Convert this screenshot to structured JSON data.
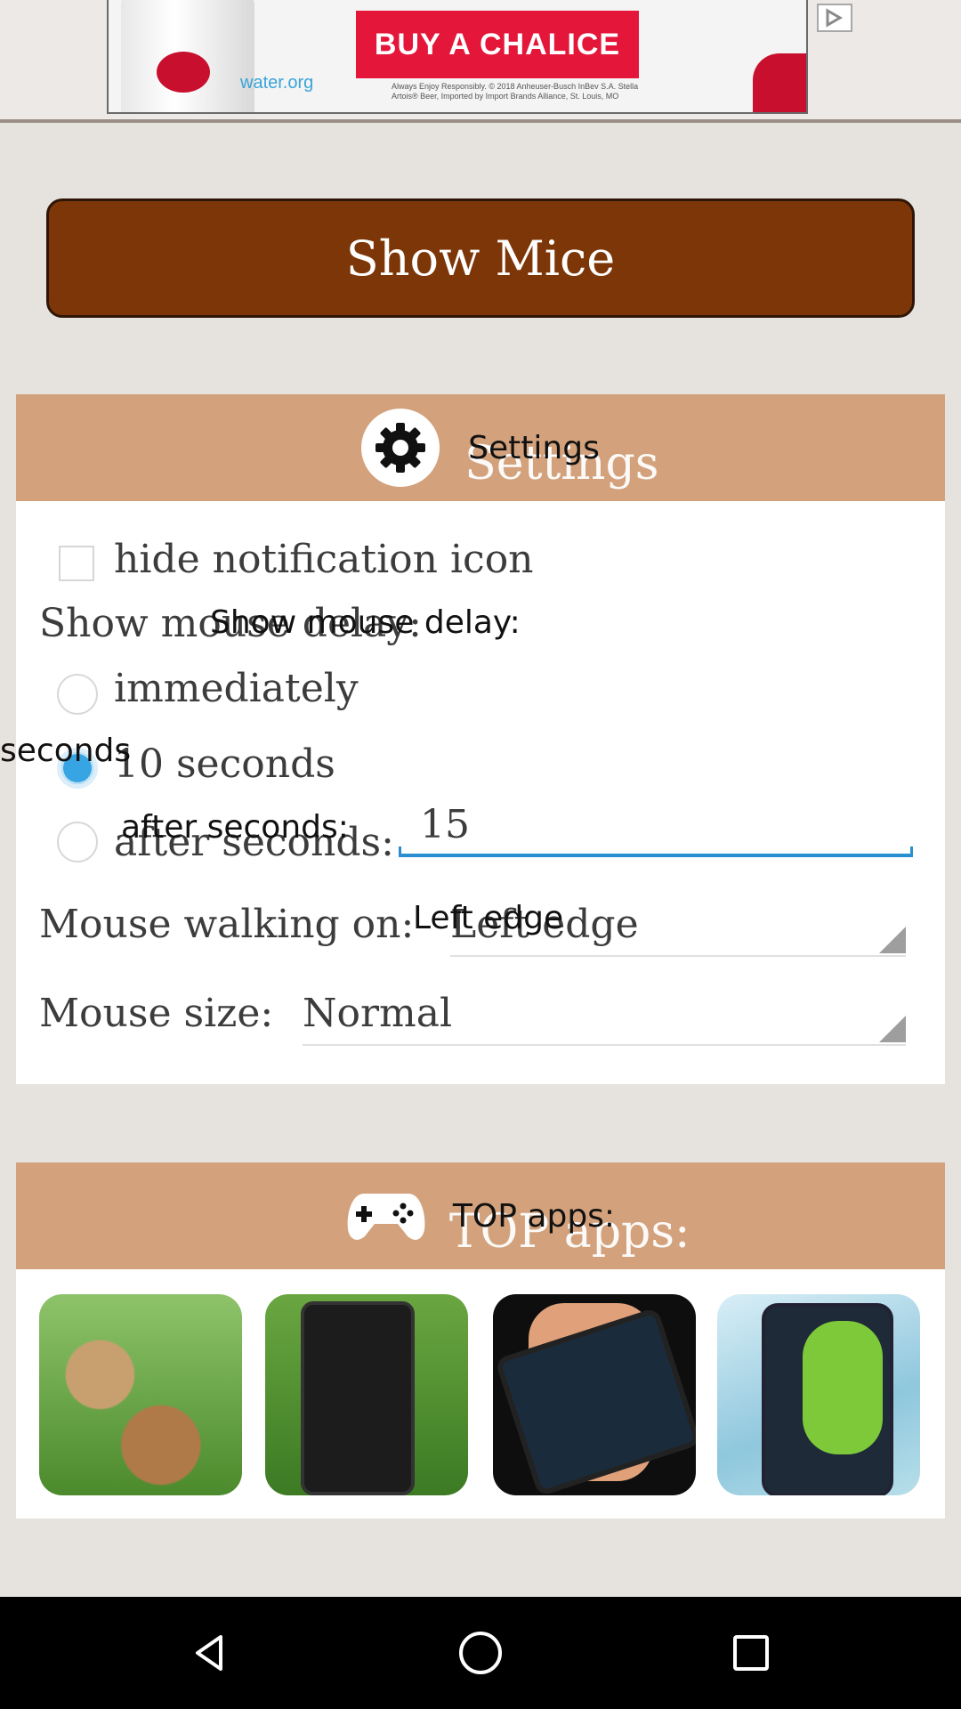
{
  "ad": {
    "cta": "BUY A CHALICE",
    "site": "water.org",
    "fine_print": "Always Enjoy Responsibly. © 2018 Anheuser-Busch InBev S.A. Stella Artois® Beer, Imported by Import Brands Alliance, St. Louis, MO",
    "brand_color": "#e4163a"
  },
  "main_button": {
    "label": "Show Mice"
  },
  "settings": {
    "header": "Settings",
    "hide_notification_label": "hide notification icon",
    "hide_notification_checked": false,
    "delay_label": "Show mouse delay:",
    "delay_overlay": "Show mouse delay:",
    "options": [
      {
        "label": "immediately",
        "selected": false
      },
      {
        "label": "10 seconds",
        "selected": true
      },
      {
        "label": "after seconds:",
        "selected": false
      }
    ],
    "seconds_overlay": "seconds",
    "after_seconds_overlay": "after seconds:",
    "after_seconds_value": "15",
    "walking_label": "Mouse walking on:",
    "walking_value": "Left edge",
    "walking_overlay": "Left edge",
    "size_label": "Mouse size:",
    "size_value": "Normal"
  },
  "top_apps": {
    "header": "TOP apps:",
    "apps": [
      {
        "icon": "snail-app-thumbnail"
      },
      {
        "icon": "ants-app-thumbnail"
      },
      {
        "icon": "xray-app-thumbnail"
      },
      {
        "icon": "frog-app-thumbnail"
      }
    ]
  },
  "colors": {
    "accent_brown": "#7d3607",
    "header_tan": "#d3a27c",
    "radio_blue": "#37a5e4"
  }
}
